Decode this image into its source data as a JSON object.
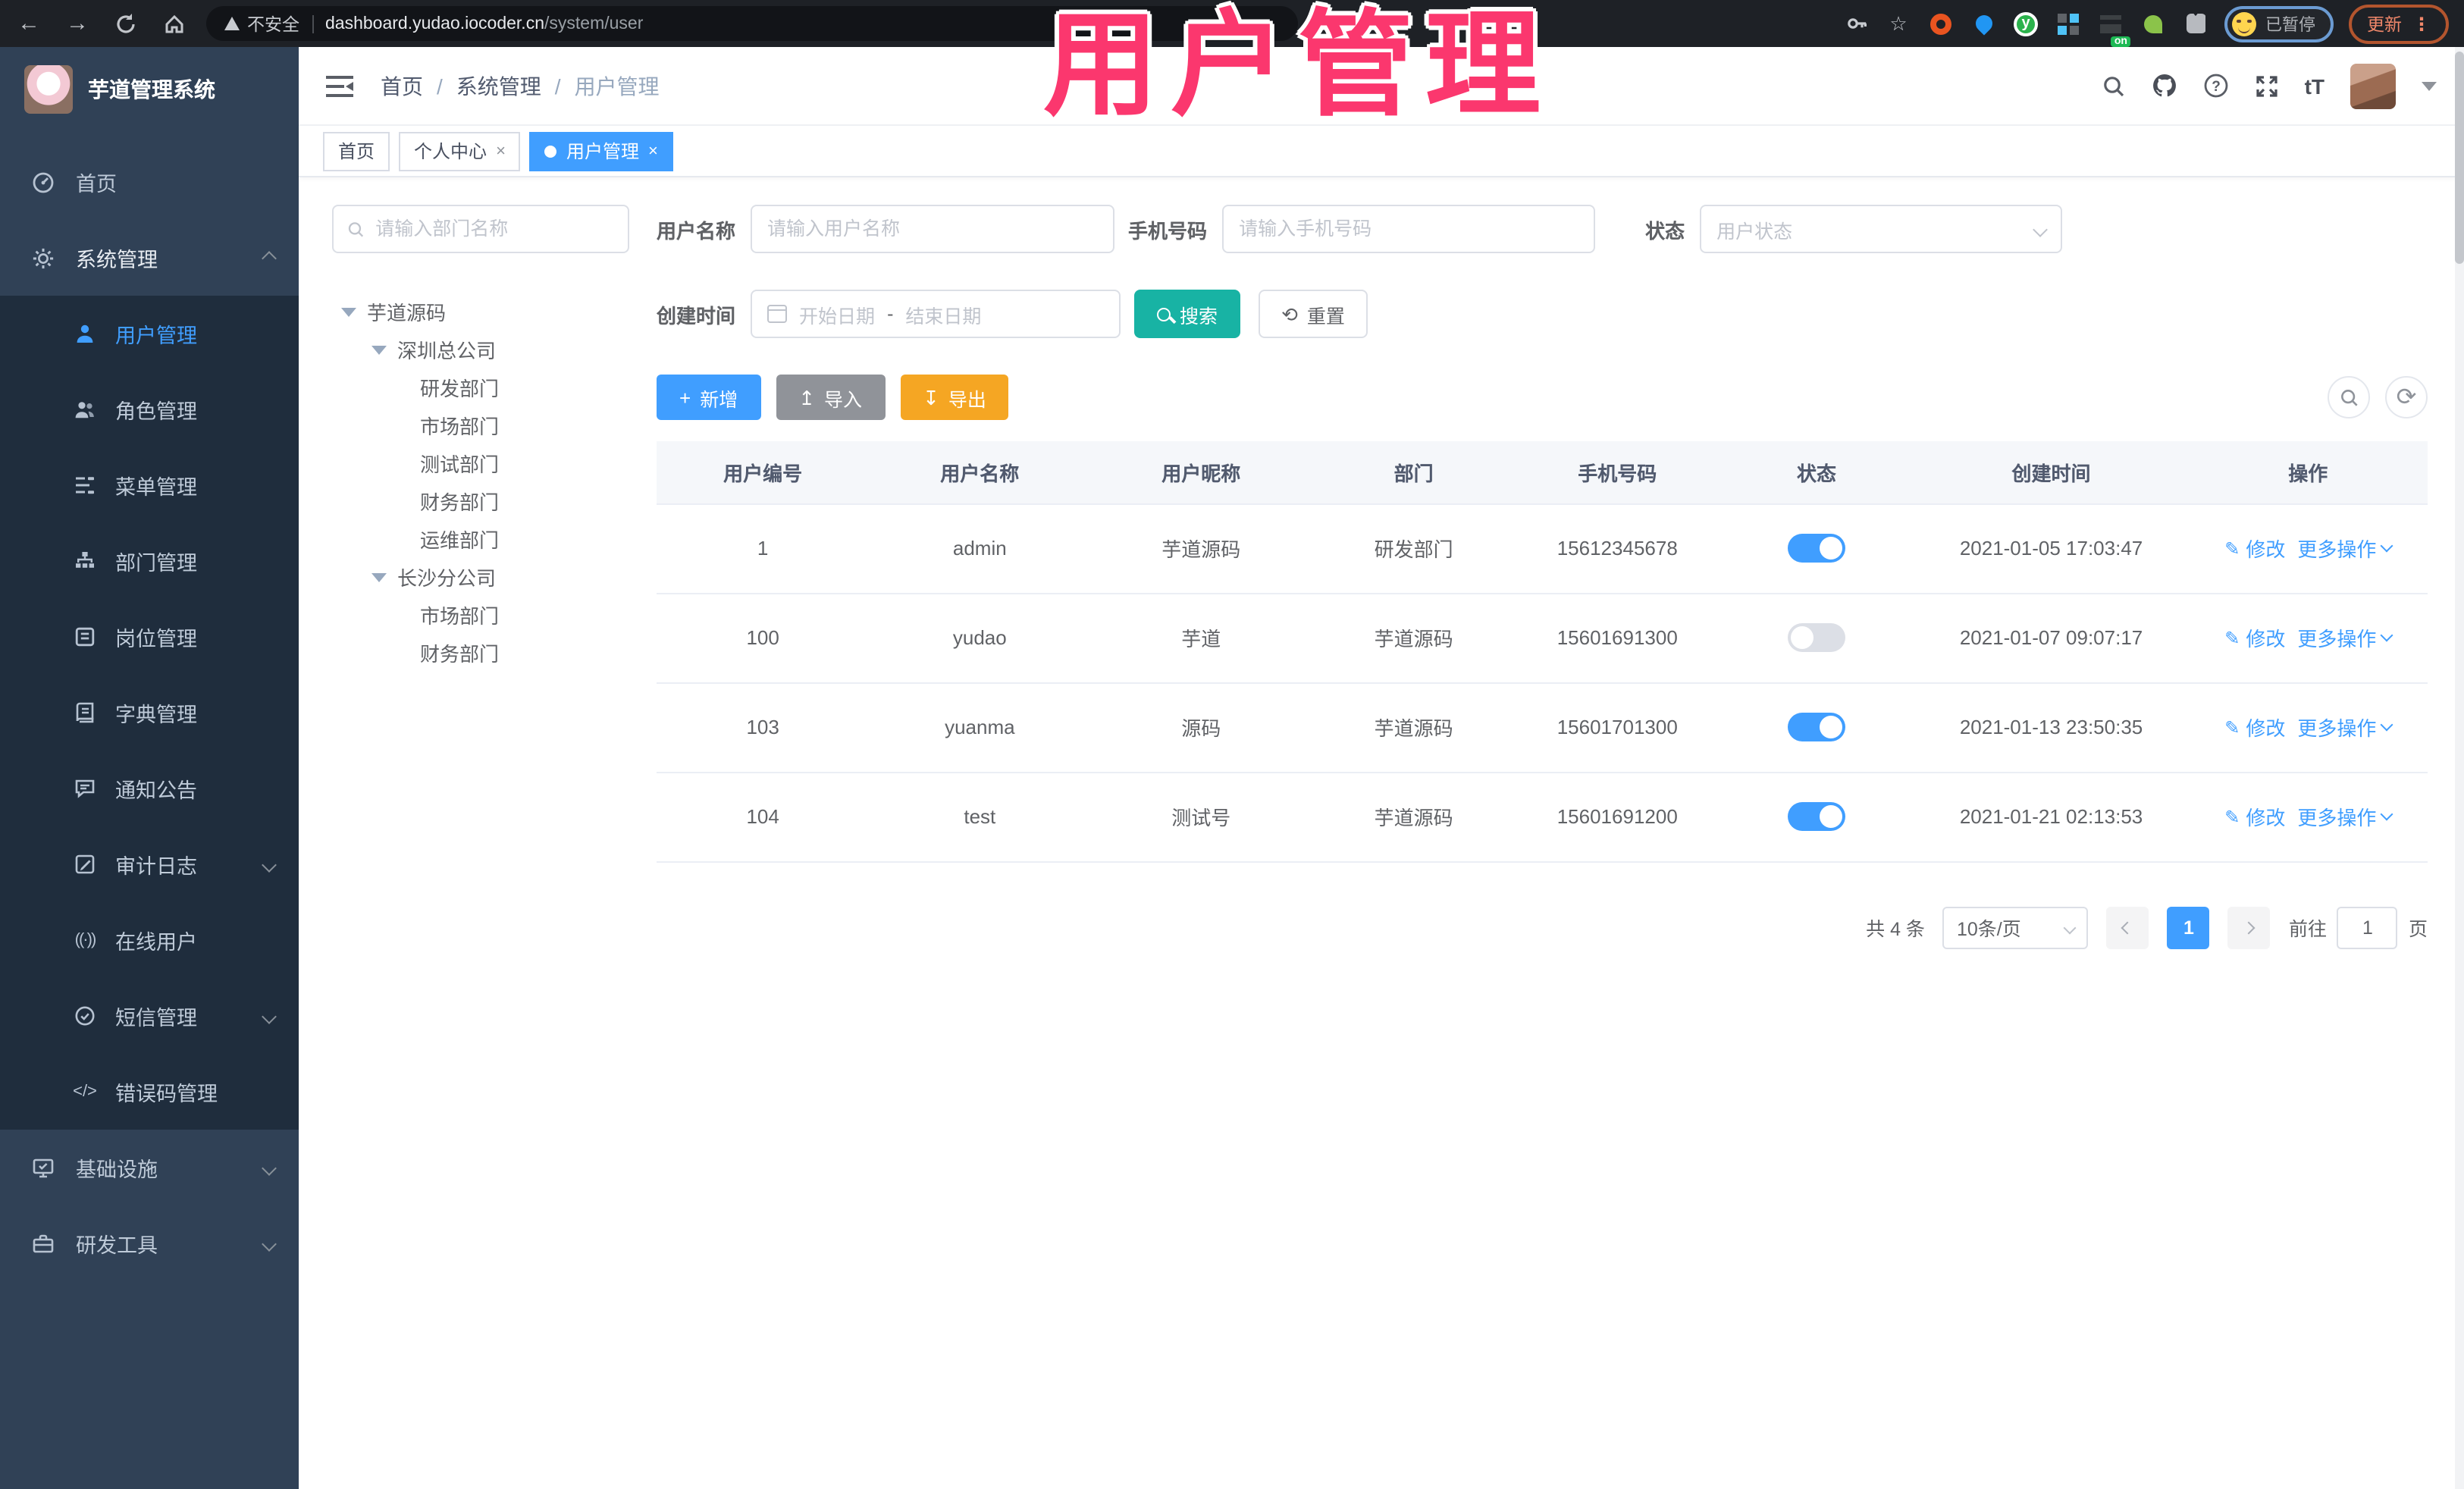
{
  "colors": {
    "primary": "#409EFF",
    "search_teal": "#18B3A4",
    "export_orange": "#F5A623",
    "import_gray": "#909399",
    "overlay_pink": "#FB376E"
  },
  "browser": {
    "insecure_label": "不安全",
    "url_host": "dashboard.yudao.iocoder.cn",
    "url_path": "/system/user",
    "ext_on_badge": "on",
    "ext_y_label": "y",
    "paused_label": "已暂停",
    "update_label": "更新",
    "menu_dots": "⋮"
  },
  "overlay": {
    "title": "用户管理"
  },
  "sidebar": {
    "logo_title": "芋道管理系统",
    "home": "首页",
    "system": "系统管理",
    "sub": [
      "用户管理",
      "角色管理",
      "菜单管理",
      "部门管理",
      "岗位管理",
      "字典管理",
      "通知公告",
      "审计日志",
      "在线用户",
      "短信管理",
      "错误码管理"
    ],
    "infra": "基础设施",
    "devtools": "研发工具"
  },
  "header": {
    "breadcrumb": [
      "首页",
      "系统管理",
      "用户管理"
    ],
    "separator": "/",
    "font_size_label": "tT"
  },
  "tabs": [
    {
      "label": "首页"
    },
    {
      "label": "个人中心"
    },
    {
      "label": "用户管理"
    }
  ],
  "dept": {
    "search_placeholder": "请输入部门名称",
    "tree": {
      "root": "芋道源码",
      "branch1": "深圳总公司",
      "branch1_children": [
        "研发部门",
        "市场部门",
        "测试部门",
        "财务部门",
        "运维部门"
      ],
      "branch2": "长沙分公司",
      "branch2_children": [
        "市场部门",
        "财务部门"
      ]
    }
  },
  "filters": {
    "username_label": "用户名称",
    "username_placeholder": "请输入用户名称",
    "mobile_label": "手机号码",
    "mobile_placeholder": "请输入手机号码",
    "status_label": "状态",
    "status_placeholder": "用户状态",
    "created_label": "创建时间",
    "date_start_placeholder": "开始日期",
    "date_separator": "-",
    "date_end_placeholder": "结束日期",
    "search_label": "搜索",
    "reset_label": "重置"
  },
  "toolbar": {
    "add_label": "新增",
    "import_label": "导入",
    "export_label": "导出"
  },
  "table": {
    "headers": [
      "用户编号",
      "用户名称",
      "用户昵称",
      "部门",
      "手机号码",
      "状态",
      "创建时间",
      "操作"
    ],
    "edit_label": "修改",
    "more_label": "更多操作",
    "rows": [
      {
        "id": "1",
        "username": "admin",
        "nickname": "芋道源码",
        "dept": "研发部门",
        "mobile": "15612345678",
        "status": "on",
        "created": "2021-01-05 17:03:47"
      },
      {
        "id": "100",
        "username": "yudao",
        "nickname": "芋道",
        "dept": "芋道源码",
        "mobile": "15601691300",
        "status": "off",
        "created": "2021-01-07 09:07:17"
      },
      {
        "id": "103",
        "username": "yuanma",
        "nickname": "源码",
        "dept": "芋道源码",
        "mobile": "15601701300",
        "status": "on",
        "created": "2021-01-13 23:50:35"
      },
      {
        "id": "104",
        "username": "test",
        "nickname": "测试号",
        "dept": "芋道源码",
        "mobile": "15601691200",
        "status": "on",
        "created": "2021-01-21 02:13:53"
      }
    ]
  },
  "pagination": {
    "total_label": "共 4 条",
    "page_size_label": "10条/页",
    "current_page": "1",
    "goto_label": "前往",
    "goto_value": "1",
    "page_unit": "页"
  }
}
